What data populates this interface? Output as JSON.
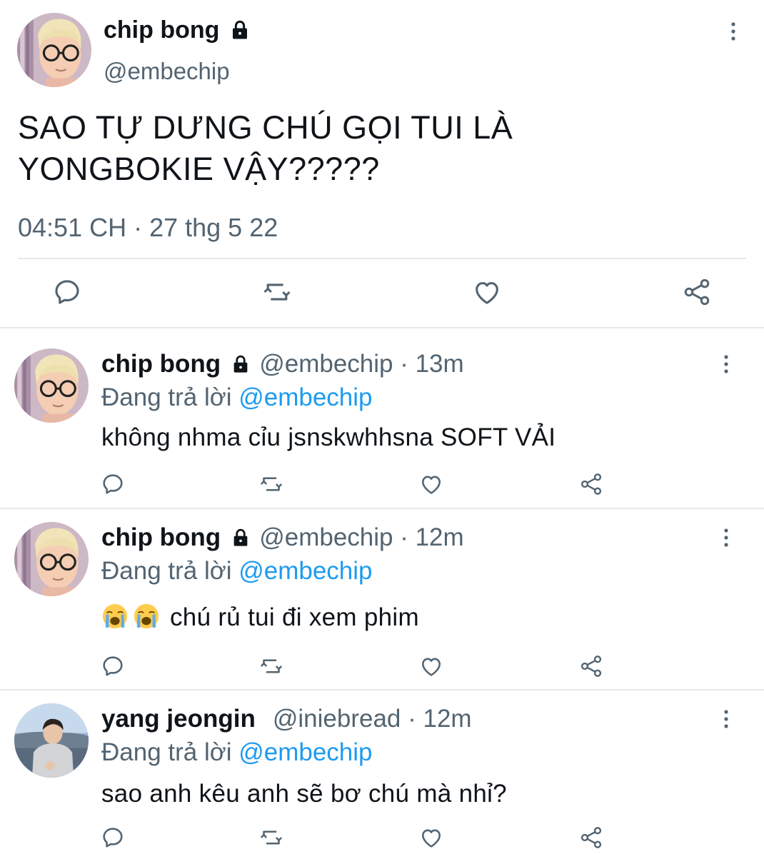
{
  "main_tweet": {
    "author_name": "chip bong",
    "author_handle": "@embechip",
    "text_line1": "SAO TỰ DƯNG CHÚ GỌI TUI LÀ",
    "text_line2": "YONGBOKIE VẬY?????",
    "meta": "04:51 CH · 27 thg 5 22",
    "actions": [
      "reply-icon",
      "retweet-icon",
      "like-icon",
      "share-icon"
    ]
  },
  "replies": [
    {
      "author_name": "chip bong",
      "locked": true,
      "handle_time": "@embechip · 13m",
      "replying_prefix": "Đang trả lời ",
      "replying_to": "@embechip",
      "text": "không nhma cỉu jsnskwhhsna SOFT VẢI"
    },
    {
      "author_name": "chip bong",
      "locked": true,
      "handle_time": "@embechip · 12m",
      "replying_prefix": "Đang trả lời ",
      "replying_to": "@embechip",
      "emojis": [
        "loudly-crying-face",
        "loudly-crying-face"
      ],
      "text": "chú rủ tui đi xem phim"
    },
    {
      "author_name": "yang jeongin",
      "locked": false,
      "handle_time": "@iniebread · 12m",
      "replying_prefix": "Đang trả lời ",
      "replying_to": "@embechip",
      "text": "sao anh kêu anh sẽ bơ chú mà nhỉ?"
    }
  ],
  "colors": {
    "text": "#0f1419",
    "secondary": "#536471",
    "link": "#1d9bf0",
    "divider": "#e6e9ec"
  }
}
